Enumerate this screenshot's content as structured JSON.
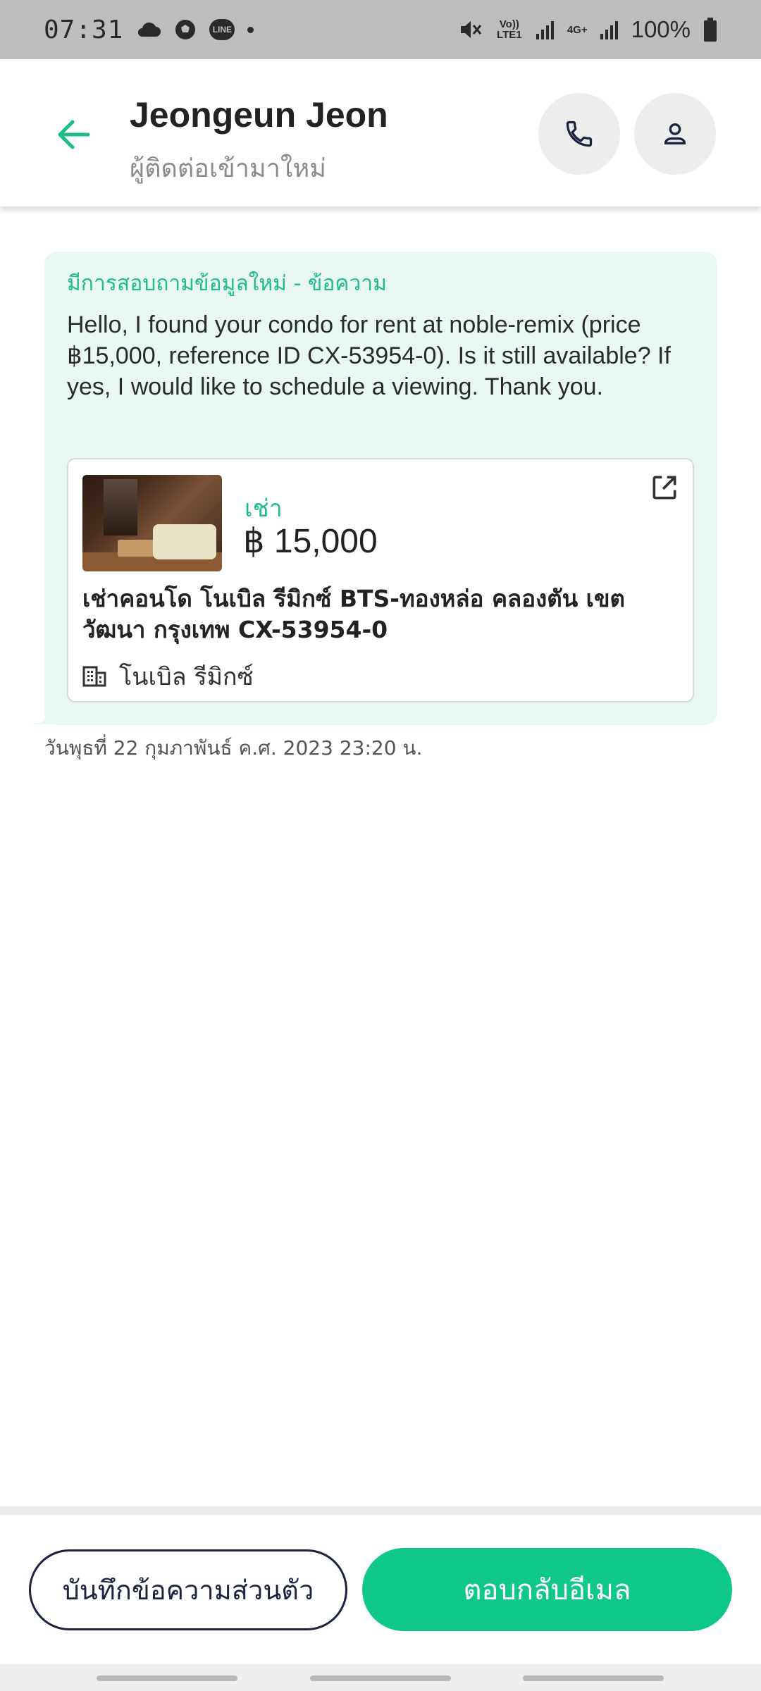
{
  "status_bar": {
    "time": "07:31",
    "icons": [
      "cloud-icon",
      "soccer-ball-icon",
      "line-app-icon",
      "dot-icon"
    ],
    "line_label": "LINE",
    "volte": "Vo)) LTE1",
    "network": "4G+",
    "battery": "100%"
  },
  "header": {
    "name": "Jeongeun Jeon",
    "subtitle": "ผู้ติดต่อเข้ามาใหม่",
    "accent_color": "#1cbd86"
  },
  "message": {
    "tag": "มีการสอบถามข้อมูลใหม่ - ข้อความ",
    "body": "Hello, I found your condo for rent at noble-remix (price ฿15,000, reference ID CX-53954-0). Is it still available? If yes, I would like to schedule a viewing. Thank you.",
    "listing": {
      "type": "เช่า",
      "price": "฿ 15,000",
      "title": "เช่าคอนโด  โนเบิล รีมิกซ์ BTS-ทองหล่อ คลองตัน เขต วัฒนา กรุงเทพ CX-53954-0",
      "project": "โนเบิล รีมิกซ์"
    },
    "timestamp": "วันพุธที่ 22 กุมภาพันธ์ ค.ศ. 2023 23:20 น."
  },
  "actions": {
    "note_label": "บันทึกข้อความส่วนตัว",
    "reply_label": "ตอบกลับอีเมล",
    "reply_color": "#0fc888"
  }
}
